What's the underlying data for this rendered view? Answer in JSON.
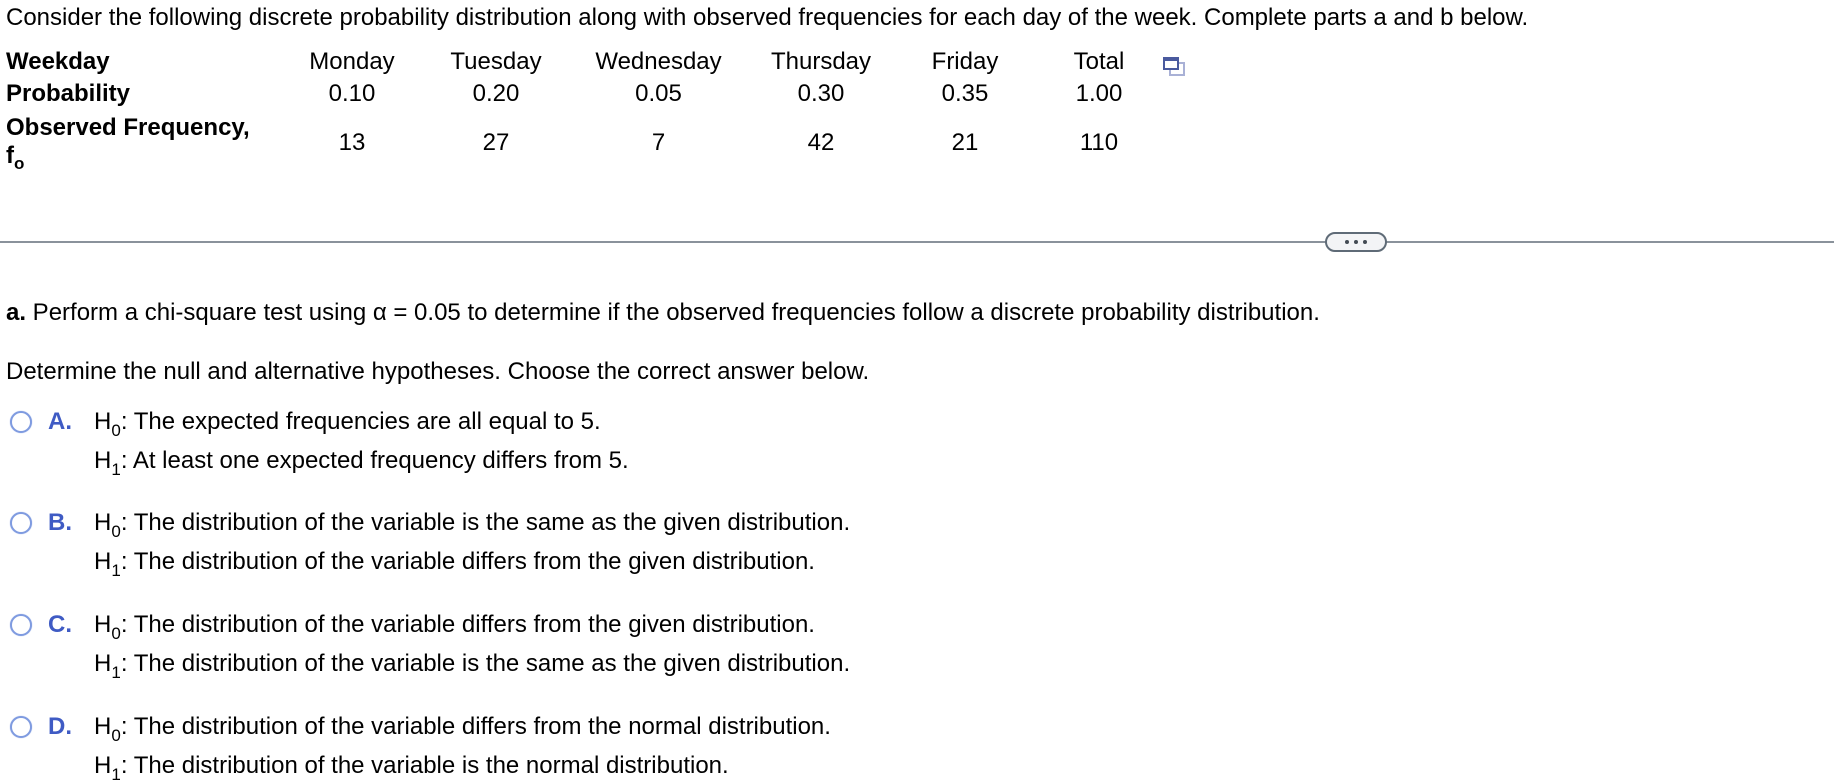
{
  "intro": "Consider the following discrete probability distribution along with observed frequencies for each day of the week. Complete parts a and b below.",
  "table": {
    "row_labels": {
      "weekday": "Weekday",
      "probability": "Probability",
      "observed_line1": "Observed Frequency,",
      "observed_symbol": "f",
      "observed_subscript": "o"
    },
    "columns": [
      "Monday",
      "Tuesday",
      "Wednesday",
      "Thursday",
      "Friday",
      "Total"
    ],
    "probabilities": [
      "0.10",
      "0.20",
      "0.05",
      "0.30",
      "0.35",
      "1.00"
    ],
    "observed": [
      "13",
      "27",
      "7",
      "42",
      "21",
      "110"
    ],
    "copy_icon": "copy-to-clipboard-icon"
  },
  "divider": {
    "more_button": "more-options-ellipsis"
  },
  "part_a": {
    "label": "a.",
    "text": " Perform a chi-square test using α = 0.05 to determine if the observed frequencies follow a discrete probability distribution."
  },
  "instruction": "Determine the null and alternative hypotheses. Choose the correct answer below.",
  "options": [
    {
      "letter": "A.",
      "h0": ": The expected frequencies are all equal to 5.",
      "h1": ": At least one expected frequency differs from 5.",
      "selected": false
    },
    {
      "letter": "B.",
      "h0": ": The distribution of the variable is the same as the given distribution.",
      "h1": ": The distribution of the variable differs from the given distribution.",
      "selected": false
    },
    {
      "letter": "C.",
      "h0": ": The distribution of the variable differs from the given distribution.",
      "h1": ": The distribution of the variable is the same as the given distribution.",
      "selected": false
    },
    {
      "letter": "D.",
      "h0": ": The distribution of the variable differs from the normal distribution.",
      "h1": ": The distribution of the variable is the normal distribution.",
      "selected": false
    }
  ],
  "hyp_symbols": {
    "h": "H",
    "null_sub": "0",
    "alt_sub": "1"
  },
  "colors": {
    "option_letter": "#3f5bc4",
    "radio_border": "#7f9be0",
    "divider": "#8a929b",
    "copy_icon": "#4a5a9e"
  }
}
